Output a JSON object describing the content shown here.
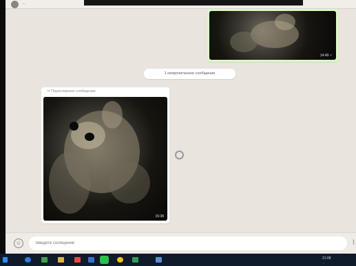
{
  "header": {
    "name": "..."
  },
  "outgoing": {
    "time": "14:49 ✓"
  },
  "date_divider": {
    "label": "1 непрочитанное сообщение"
  },
  "incoming": {
    "forwarded_label": "⇒ Пересланное сообщение",
    "time": "15:38"
  },
  "composer": {
    "placeholder": "Введите сообщение"
  },
  "taskbar": {
    "icons": [
      "start-icon",
      "search-icon",
      "task-view-icon",
      "file-explorer-icon",
      "store-icon",
      "word-icon",
      "whatsapp-icon",
      "chrome-icon",
      "excel-icon",
      "files-icon"
    ],
    "tray_time": "21:08",
    "tray_date": "..."
  },
  "colors": {
    "chat_background": "#e9e4dd",
    "outgoing_bubble": "#dbf8c6",
    "incoming_bubble": "#ffffff",
    "taskbar": "#0f1a2a"
  }
}
